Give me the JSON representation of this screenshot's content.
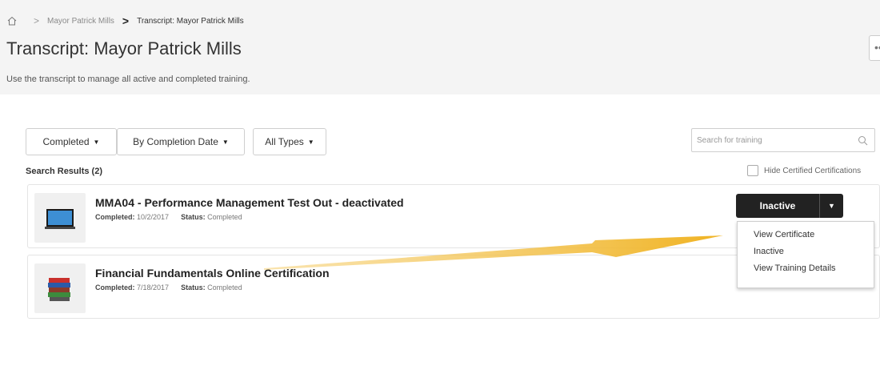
{
  "breadcrumb": {
    "items": [
      "Mayor Patrick Mills",
      "Transcript: Mayor Patrick Mills"
    ]
  },
  "page": {
    "title": "Transcript: Mayor Patrick Mills",
    "description": "Use the transcript to manage all active and completed training.",
    "overflow_label": "••"
  },
  "filters": {
    "status": "Completed",
    "sort": "By Completion Date",
    "type": "All Types"
  },
  "search": {
    "placeholder": "Search for training",
    "value": ""
  },
  "results": {
    "count_label": "Search Results (2)",
    "hide_certified_label": "Hide Certified Certifications",
    "items": [
      {
        "title": "MMA04 - Performance Management Test Out - deactivated",
        "completed_label": "Completed:",
        "completed_date": "10/2/2017",
        "status_label": "Status:",
        "status_value": "Completed",
        "thumbnail_icon": "laptop-icon"
      },
      {
        "title": "Financial Fundamentals Online Certification",
        "completed_label": "Completed:",
        "completed_date": "7/18/2017",
        "status_label": "Status:",
        "status_value": "Completed",
        "thumbnail_icon": "books-icon"
      }
    ]
  },
  "action_button": {
    "label": "Inactive"
  },
  "action_menu": {
    "items": [
      "View Certificate",
      "Inactive",
      "View Training Details"
    ]
  },
  "colors": {
    "accent_arrow": "#f0b323",
    "action_button_bg": "#222222"
  }
}
